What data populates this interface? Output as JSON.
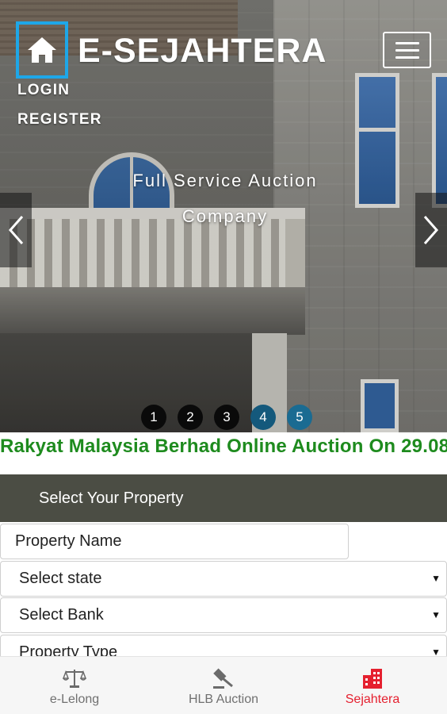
{
  "header": {
    "brand": "E-SEJAHTERA",
    "nav": {
      "login": "LOGIN",
      "register": "REGISTER"
    },
    "home_icon": "home-icon",
    "menu_icon": "hamburger-menu-icon",
    "accent": "#1ea7e8"
  },
  "hero": {
    "tagline_line1": "Full Service Auction",
    "tagline_line2": "Company",
    "prev_icon": "chevron-left-icon",
    "next_icon": "chevron-right-icon",
    "slides": [
      "1",
      "2",
      "3",
      "4",
      "5"
    ],
    "active_slide": "5"
  },
  "marquee": {
    "text": "Rakyat Malaysia Berhad Online Auction On 29.08",
    "color": "#1e8b1e"
  },
  "search": {
    "heading": "Select Your Property",
    "property_name_placeholder": "Property Name",
    "state_select": "Select state",
    "bank_select": "Select Bank",
    "type_select": "Property Type",
    "header_color": "#4b4d44"
  },
  "bottom_nav": {
    "tabs": [
      {
        "label": "e-Lelong",
        "icon": "scales-icon",
        "active": false
      },
      {
        "label": "HLB Auction",
        "icon": "gavel-icon",
        "active": false
      },
      {
        "label": "Sejahtera",
        "icon": "building-icon",
        "active": true
      }
    ],
    "active_color": "#e5202f"
  }
}
